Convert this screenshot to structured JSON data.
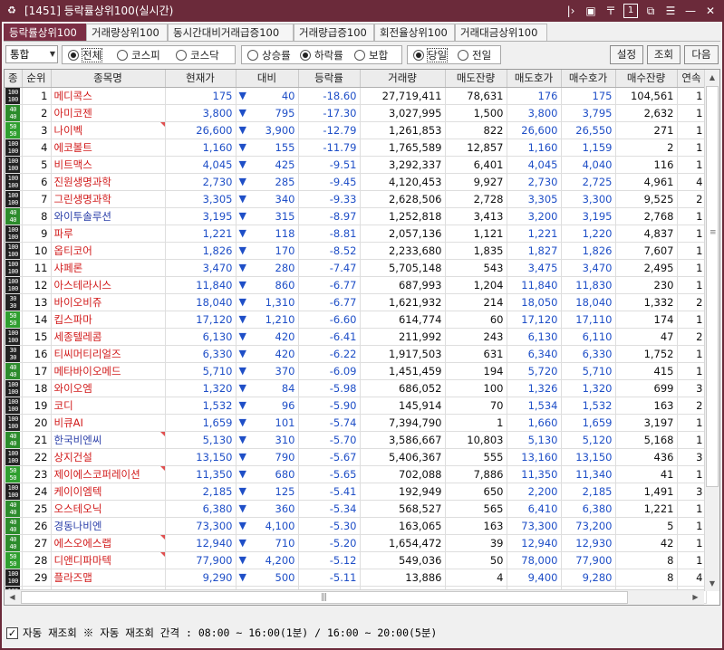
{
  "window": {
    "title": "[1451] 등락률상위100(실시간)",
    "icon": "chart-icon"
  },
  "titlebar_buttons": [
    {
      "name": "pin-icon",
      "glyph": "|>"
    },
    {
      "name": "dock-icon",
      "glyph": "▣"
    },
    {
      "name": "marker-icon",
      "glyph": "〒"
    },
    {
      "name": "number-icon",
      "glyph": "1"
    },
    {
      "name": "window-icon",
      "glyph": "⧉"
    },
    {
      "name": "list-icon",
      "glyph": "☰"
    },
    {
      "name": "minimize-icon",
      "glyph": "—"
    },
    {
      "name": "close-icon",
      "glyph": "✕"
    }
  ],
  "tabs": [
    "등락률상위100",
    "거래량상위100",
    "동시간대비거래급증100",
    "거래량급증100",
    "회전율상위100",
    "거래대금상위100"
  ],
  "market_select": "통합",
  "market_options": [
    {
      "label": "전체",
      "on": true
    },
    {
      "label": "코스피",
      "on": false
    },
    {
      "label": "코스닥",
      "on": false
    }
  ],
  "direction_options": [
    {
      "label": "상승률",
      "on": false
    },
    {
      "label": "하락률",
      "on": true
    },
    {
      "label": "보합",
      "on": false
    }
  ],
  "day_options": [
    {
      "label": "당일",
      "on": true
    },
    {
      "label": "전일",
      "on": false
    }
  ],
  "buttons": {
    "settings": "설정",
    "query": "조회",
    "next": "다음"
  },
  "columns": [
    "종",
    "순위",
    "종목명",
    "현재가",
    "대비",
    "등락률",
    "거래량",
    "매도잔량",
    "매도호가",
    "매수호가",
    "매수잔량",
    "연속"
  ],
  "rows": [
    {
      "b": "100",
      "rank": "1",
      "name": "메디콕스",
      "price": "175",
      "chg": "40",
      "rate": "-18.60",
      "vol": "27,719,411",
      "sq": "78,631",
      "ask": "176",
      "bid": "175",
      "bq": "104,561",
      "cont": "1",
      "flag": false,
      "nb": false,
      "ac": "blue",
      "bc": "blue"
    },
    {
      "b": "40",
      "rank": "2",
      "name": "아미코젠",
      "price": "3,800",
      "chg": "795",
      "rate": "-17.30",
      "vol": "3,027,995",
      "sq": "1,500",
      "ask": "3,800",
      "bid": "3,795",
      "bq": "2,632",
      "cont": "1",
      "flag": false,
      "nb": false,
      "ac": "blue",
      "bc": "blue"
    },
    {
      "b": "50",
      "rank": "3",
      "name": "나이벡",
      "price": "26,600",
      "chg": "3,900",
      "rate": "-12.79",
      "vol": "1,261,853",
      "sq": "822",
      "ask": "26,600",
      "bid": "26,550",
      "bq": "271",
      "cont": "1",
      "flag": true,
      "nb": false,
      "ac": "blue",
      "bc": "blue"
    },
    {
      "b": "100",
      "rank": "4",
      "name": "에코볼트",
      "price": "1,160",
      "chg": "155",
      "rate": "-11.79",
      "vol": "1,765,589",
      "sq": "12,857",
      "ask": "1,160",
      "bid": "1,159",
      "bq": "2",
      "cont": "1",
      "flag": false,
      "nb": false,
      "ac": "blue",
      "bc": "blue"
    },
    {
      "b": "100",
      "rank": "5",
      "name": "비트맥스",
      "price": "4,045",
      "chg": "425",
      "rate": "-9.51",
      "vol": "3,292,337",
      "sq": "6,401",
      "ask": "4,045",
      "bid": "4,040",
      "bq": "116",
      "cont": "1",
      "flag": false,
      "nb": false,
      "ac": "blue",
      "bc": "blue"
    },
    {
      "b": "100",
      "rank": "6",
      "name": "진원생명과학",
      "price": "2,730",
      "chg": "285",
      "rate": "-9.45",
      "vol": "4,120,453",
      "sq": "9,927",
      "ask": "2,730",
      "bid": "2,725",
      "bq": "4,961",
      "cont": "4",
      "flag": false,
      "nb": false,
      "ac": "blue",
      "bc": "blue"
    },
    {
      "b": "100",
      "rank": "7",
      "name": "그린생명과학",
      "price": "3,305",
      "chg": "340",
      "rate": "-9.33",
      "vol": "2,628,506",
      "sq": "2,728",
      "ask": "3,305",
      "bid": "3,300",
      "bq": "9,525",
      "cont": "2",
      "flag": false,
      "nb": false,
      "ac": "blue",
      "bc": "blue"
    },
    {
      "b": "40",
      "rank": "8",
      "name": "와이투솔루션",
      "price": "3,195",
      "chg": "315",
      "rate": "-8.97",
      "vol": "1,252,818",
      "sq": "3,413",
      "ask": "3,200",
      "bid": "3,195",
      "bq": "2,768",
      "cont": "1",
      "flag": false,
      "nb": true,
      "ac": "blue",
      "bc": "blue"
    },
    {
      "b": "100",
      "rank": "9",
      "name": "파루",
      "price": "1,221",
      "chg": "118",
      "rate": "-8.81",
      "vol": "2,057,136",
      "sq": "1,121",
      "ask": "1,221",
      "bid": "1,220",
      "bq": "4,837",
      "cont": "1",
      "flag": false,
      "nb": false,
      "ac": "blue",
      "bc": "blue"
    },
    {
      "b": "100",
      "rank": "10",
      "name": "옵티코어",
      "price": "1,826",
      "chg": "170",
      "rate": "-8.52",
      "vol": "2,233,680",
      "sq": "1,835",
      "ask": "1,827",
      "bid": "1,826",
      "bq": "7,607",
      "cont": "1",
      "flag": false,
      "nb": false,
      "ac": "blue",
      "bc": "blue"
    },
    {
      "b": "100",
      "rank": "11",
      "name": "샤페론",
      "price": "3,470",
      "chg": "280",
      "rate": "-7.47",
      "vol": "5,705,148",
      "sq": "543",
      "ask": "3,475",
      "bid": "3,470",
      "bq": "2,495",
      "cont": "1",
      "flag": false,
      "nb": false,
      "ac": "blue",
      "bc": "blue"
    },
    {
      "b": "100",
      "rank": "12",
      "name": "아스테라시스",
      "price": "11,840",
      "chg": "860",
      "rate": "-6.77",
      "vol": "687,993",
      "sq": "1,204",
      "ask": "11,840",
      "bid": "11,830",
      "bq": "230",
      "cont": "1",
      "flag": false,
      "nb": false,
      "ac": "blue",
      "bc": "blue"
    },
    {
      "b": "30",
      "rank": "13",
      "name": "바이오비쥬",
      "price": "18,040",
      "chg": "1,310",
      "rate": "-6.77",
      "vol": "1,621,932",
      "sq": "214",
      "ask": "18,050",
      "bid": "18,040",
      "bq": "1,332",
      "cont": "2",
      "flag": false,
      "nb": false,
      "ac": "blue",
      "bc": "blue"
    },
    {
      "b": "50",
      "rank": "14",
      "name": "킵스파마",
      "price": "17,120",
      "chg": "1,210",
      "rate": "-6.60",
      "vol": "614,774",
      "sq": "60",
      "ask": "17,120",
      "bid": "17,110",
      "bq": "174",
      "cont": "1",
      "flag": false,
      "nb": false,
      "ac": "blue",
      "bc": "blue"
    },
    {
      "b": "100",
      "rank": "15",
      "name": "세종텔레콤",
      "price": "6,130",
      "chg": "420",
      "rate": "-6.41",
      "vol": "211,992",
      "sq": "243",
      "ask": "6,130",
      "bid": "6,110",
      "bq": "47",
      "cont": "2",
      "flag": false,
      "nb": false,
      "ac": "blue",
      "bc": "blue"
    },
    {
      "b": "30",
      "rank": "16",
      "name": "티씨머티리얼즈",
      "price": "6,330",
      "chg": "420",
      "rate": "-6.22",
      "vol": "1,917,503",
      "sq": "631",
      "ask": "6,340",
      "bid": "6,330",
      "bq": "1,752",
      "cont": "1",
      "flag": false,
      "nb": false,
      "ac": "blue",
      "bc": "blue"
    },
    {
      "b": "40",
      "rank": "17",
      "name": "메타바이오메드",
      "price": "5,710",
      "chg": "370",
      "rate": "-6.09",
      "vol": "1,451,459",
      "sq": "194",
      "ask": "5,720",
      "bid": "5,710",
      "bq": "415",
      "cont": "1",
      "flag": false,
      "nb": false,
      "ac": "blue",
      "bc": "blue"
    },
    {
      "b": "100",
      "rank": "18",
      "name": "와이오엠",
      "price": "1,320",
      "chg": "84",
      "rate": "-5.98",
      "vol": "686,052",
      "sq": "100",
      "ask": "1,326",
      "bid": "1,320",
      "bq": "699",
      "cont": "3",
      "flag": false,
      "nb": false,
      "ac": "blue",
      "bc": "blue"
    },
    {
      "b": "100",
      "rank": "19",
      "name": "코디",
      "price": "1,532",
      "chg": "96",
      "rate": "-5.90",
      "vol": "145,914",
      "sq": "70",
      "ask": "1,534",
      "bid": "1,532",
      "bq": "163",
      "cont": "2",
      "flag": false,
      "nb": false,
      "ac": "blue",
      "bc": "blue"
    },
    {
      "b": "100",
      "rank": "20",
      "name": "비큐AI",
      "price": "1,659",
      "chg": "101",
      "rate": "-5.74",
      "vol": "7,394,790",
      "sq": "1",
      "ask": "1,660",
      "bid": "1,659",
      "bq": "3,197",
      "cont": "1",
      "flag": false,
      "nb": false,
      "ac": "blue",
      "bc": "blue"
    },
    {
      "b": "40",
      "rank": "21",
      "name": "한국비엔씨",
      "price": "5,130",
      "chg": "310",
      "rate": "-5.70",
      "vol": "3,586,667",
      "sq": "10,803",
      "ask": "5,130",
      "bid": "5,120",
      "bq": "5,168",
      "cont": "1",
      "flag": true,
      "nb": true,
      "ac": "blue",
      "bc": "blue"
    },
    {
      "b": "100",
      "rank": "22",
      "name": "상지건설",
      "price": "13,150",
      "chg": "790",
      "rate": "-5.67",
      "vol": "5,406,367",
      "sq": "555",
      "ask": "13,160",
      "bid": "13,150",
      "bq": "436",
      "cont": "3",
      "flag": false,
      "nb": false,
      "ac": "blue",
      "bc": "blue"
    },
    {
      "b": "50",
      "rank": "23",
      "name": "제이에스코퍼레이션",
      "price": "11,350",
      "chg": "680",
      "rate": "-5.65",
      "vol": "702,088",
      "sq": "7,886",
      "ask": "11,350",
      "bid": "11,340",
      "bq": "41",
      "cont": "1",
      "flag": true,
      "nb": false,
      "ac": "blue",
      "bc": "blue"
    },
    {
      "b": "100",
      "rank": "24",
      "name": "케이이엠텍",
      "price": "2,185",
      "chg": "125",
      "rate": "-5.41",
      "vol": "192,949",
      "sq": "650",
      "ask": "2,200",
      "bid": "2,185",
      "bq": "1,491",
      "cont": "3",
      "flag": false,
      "nb": false,
      "ac": "blue",
      "bc": "blue"
    },
    {
      "b": "40",
      "rank": "25",
      "name": "오스테오닉",
      "price": "6,380",
      "chg": "360",
      "rate": "-5.34",
      "vol": "568,527",
      "sq": "565",
      "ask": "6,410",
      "bid": "6,380",
      "bq": "1,221",
      "cont": "1",
      "flag": false,
      "nb": false,
      "ac": "blue",
      "bc": "blue"
    },
    {
      "b": "40",
      "rank": "26",
      "name": "경동나비엔",
      "price": "73,300",
      "chg": "4,100",
      "rate": "-5.30",
      "vol": "163,065",
      "sq": "163",
      "ask": "73,300",
      "bid": "73,200",
      "bq": "5",
      "cont": "1",
      "flag": false,
      "nb": true,
      "ac": "blue",
      "bc": "blue"
    },
    {
      "b": "40",
      "rank": "27",
      "name": "에스오에스랩",
      "price": "12,940",
      "chg": "710",
      "rate": "-5.20",
      "vol": "1,654,472",
      "sq": "39",
      "ask": "12,940",
      "bid": "12,930",
      "bq": "42",
      "cont": "1",
      "flag": true,
      "nb": false,
      "ac": "blue",
      "bc": "blue"
    },
    {
      "b": "50",
      "rank": "28",
      "name": "디앤디파마텍",
      "price": "77,900",
      "chg": "4,200",
      "rate": "-5.12",
      "vol": "549,036",
      "sq": "50",
      "ask": "78,000",
      "bid": "77,900",
      "bq": "8",
      "cont": "1",
      "flag": true,
      "nb": false,
      "ac": "blue",
      "bc": "blue"
    },
    {
      "b": "100",
      "rank": "29",
      "name": "플라즈맵",
      "price": "9,290",
      "chg": "500",
      "rate": "-5.11",
      "vol": "13,886",
      "sq": "4",
      "ask": "9,400",
      "bid": "9,280",
      "bq": "8",
      "cont": "4",
      "flag": false,
      "nb": false,
      "ac": "blue",
      "bc": "blue"
    },
    {
      "b": "100",
      "rank": "30",
      "name": "컨버스엔",
      "price": "4,560",
      "chg": "245",
      "rate": "-5.10",
      "vol": "234,276",
      "sq": "291",
      "ask": "4,590",
      "bid": "4,560",
      "bq": "1,283",
      "cont": "2",
      "flag": false,
      "nb": false,
      "ac": "blue",
      "bc": "blue"
    }
  ],
  "status": {
    "auto_label": "자동 재조회",
    "auto_checked": true,
    "info": "※ 자동 재조회 간격 : 08:00 ~ 16:00(1분) / 16:00 ~ 20:00(5분)"
  },
  "colors": {
    "frame": "#6b2a3a",
    "tab_active": "#7b2e44",
    "down": "#1f4fc7",
    "name_red": "#d11a1a"
  }
}
